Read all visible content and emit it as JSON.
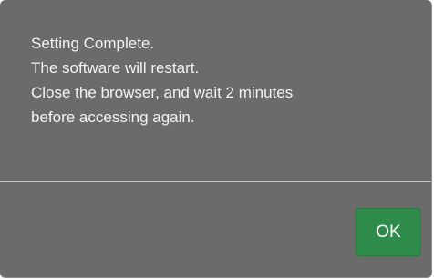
{
  "dialog": {
    "message_lines": [
      "Setting Complete.",
      "The software will restart.",
      "Close the browser, and wait 2 minutes",
      "before accessing again."
    ],
    "ok_label": "OK"
  },
  "colors": {
    "dialog_background": "#6b6b6b",
    "text": "#f2f2f2",
    "ok_button": "#2e8b4a",
    "divider": "#c8c8c8"
  }
}
